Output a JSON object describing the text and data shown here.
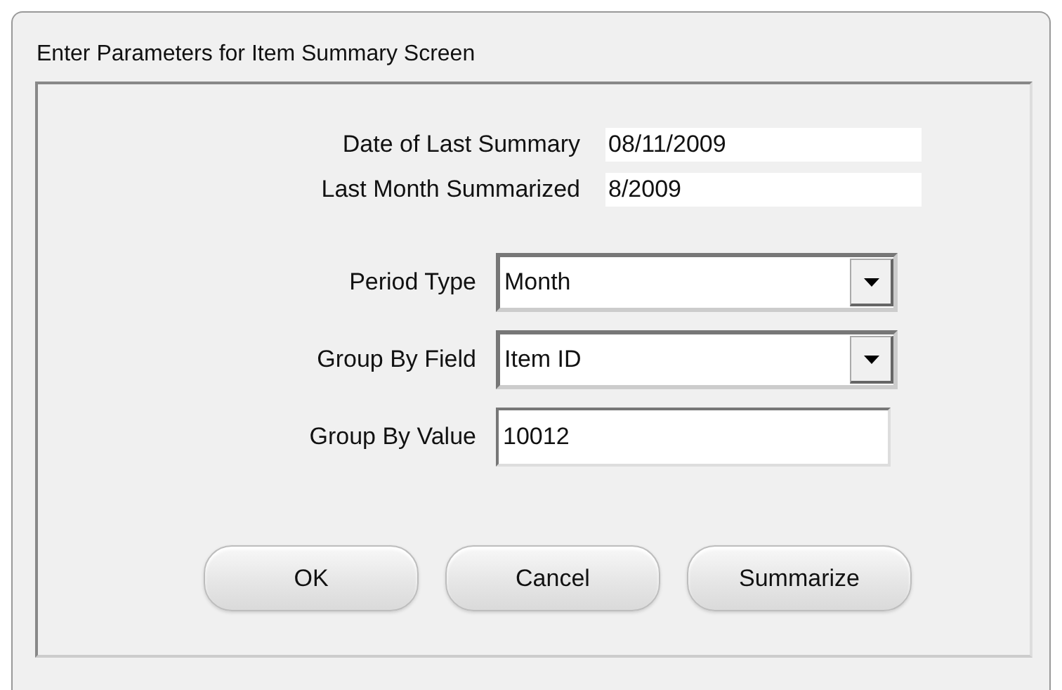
{
  "window": {
    "title": "Enter Parameters for Item Summary Screen"
  },
  "info": [
    {
      "label": "Date of Last Summary",
      "value": "08/11/2009"
    },
    {
      "label": "Last Month Summarized",
      "value": "8/2009"
    }
  ],
  "fields": [
    {
      "kind": "dropdown",
      "label": "Period Type",
      "value": "Month"
    },
    {
      "kind": "dropdown",
      "label": "Group By Field",
      "value": "Item ID"
    },
    {
      "kind": "text",
      "label": "Group By Value",
      "value": "10012"
    }
  ],
  "buttons": [
    "OK",
    "Cancel",
    "Summarize"
  ]
}
